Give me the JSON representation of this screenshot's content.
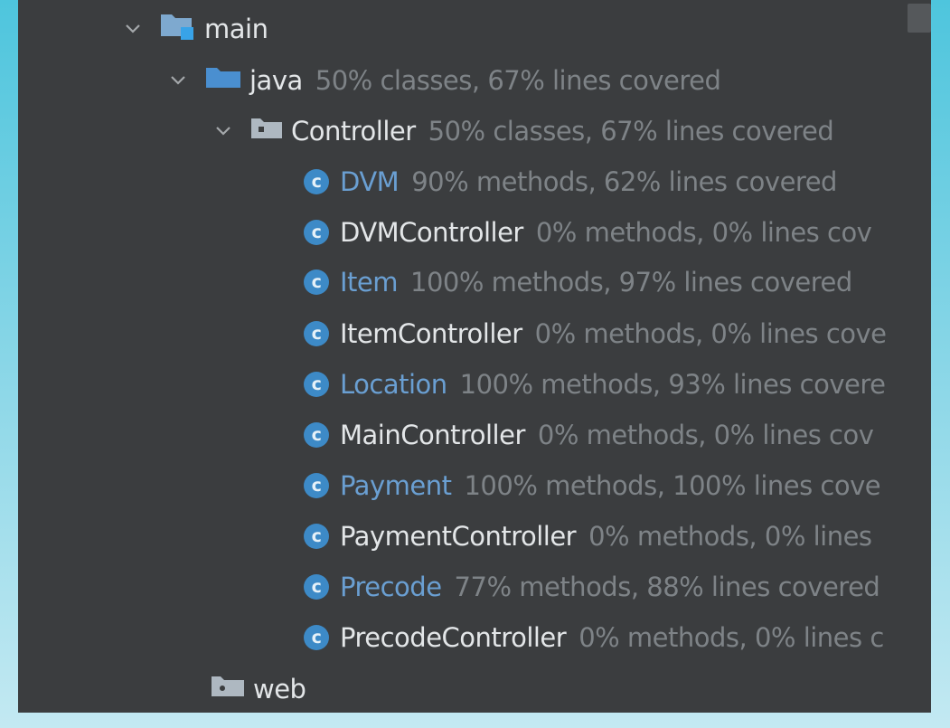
{
  "tree": {
    "main": {
      "label": "main"
    },
    "java": {
      "label": "java",
      "coverage": "50% classes, 67% lines covered"
    },
    "controller": {
      "label": "Controller",
      "coverage": "50% classes, 67% lines covered"
    },
    "classes": [
      {
        "name": "DVM",
        "coverage": "90% methods, 62% lines covered"
      },
      {
        "name": "DVMController",
        "coverage": "0% methods, 0% lines cov"
      },
      {
        "name": "Item",
        "coverage": "100% methods, 97% lines covered"
      },
      {
        "name": "ItemController",
        "coverage": "0% methods, 0% lines cove"
      },
      {
        "name": "Location",
        "coverage": "100% methods, 93% lines covere"
      },
      {
        "name": "MainController",
        "coverage": "0% methods, 0% lines cov"
      },
      {
        "name": "Payment",
        "coverage": "100% methods, 100% lines cove"
      },
      {
        "name": "PaymentController",
        "coverage": "0% methods, 0% lines"
      },
      {
        "name": "Precode",
        "coverage": "77% methods, 88% lines covered"
      },
      {
        "name": "PrecodeController",
        "coverage": "0% methods, 0% lines c"
      }
    ],
    "web": {
      "label": "web"
    }
  },
  "icons": {
    "class_letter": "c",
    "chevron": "chevron-down-icon",
    "folder": "folder-icon",
    "class": "class-icon"
  },
  "colors": {
    "panel_bg": "#3b3d3f",
    "name_default": "#e3e6e8",
    "name_covered": "#6a9fd2",
    "coverage_text": "#7e8387",
    "class_icon": "#3d8ac7",
    "folder_icon": "#7ea9cf",
    "module_badge": "#38a3e8"
  }
}
